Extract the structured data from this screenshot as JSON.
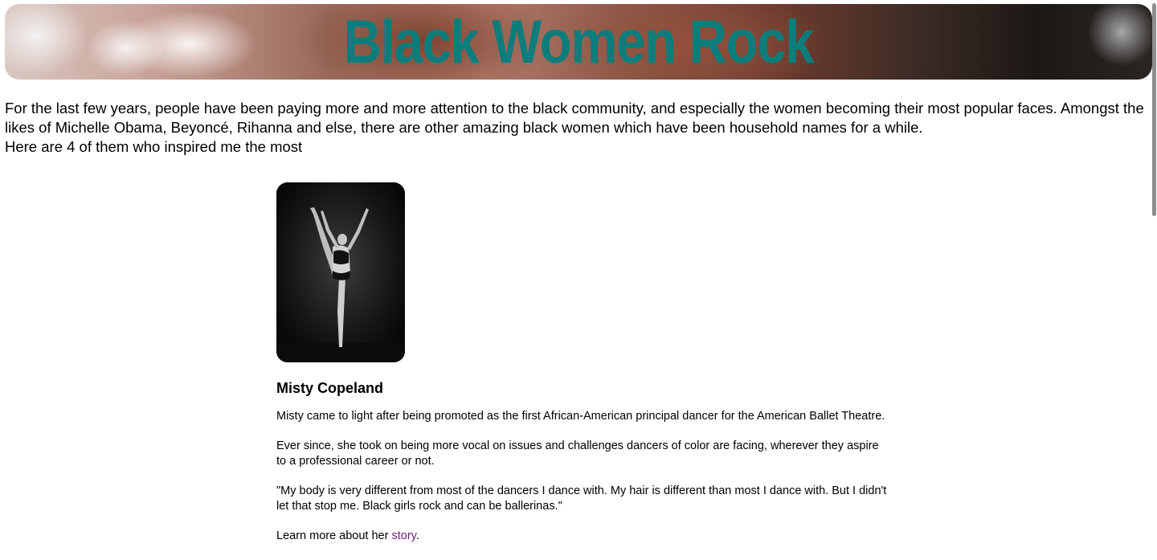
{
  "header": {
    "title": "Black Women Rock"
  },
  "intro": {
    "paragraph": "For the last few years, people have been paying more and more attention to the black community, and especially the women becoming their most popular faces. Amongst the likes of Michelle Obama, Beyoncé, Rihanna and else, there are other amazing black women which have been household names for a while.",
    "lead": "Here are 4 of them who inspired me the most"
  },
  "profiles": [
    {
      "name": "Misty Copeland",
      "photo_alt": "ballet-dancer-photo",
      "p1": "Misty came to light after being promoted as the first African-American principal dancer for the American Ballet Theatre.",
      "p2": "Ever since, she took on being more vocal on issues and challenges dancers of color are facing, wherever they aspire to a professional career or not.",
      "quote": "\"My body is very different from most of the dancers I dance with. My hair is different than most I dance with. But I didn't let that stop me. Black girls rock and can be ballerinas.\"",
      "learn_prefix": "Learn more about her ",
      "learn_link": "story",
      "learn_suffix": "."
    }
  ],
  "colors": {
    "title": "#0b7d7c",
    "link_visited": "#6b1c7a"
  }
}
